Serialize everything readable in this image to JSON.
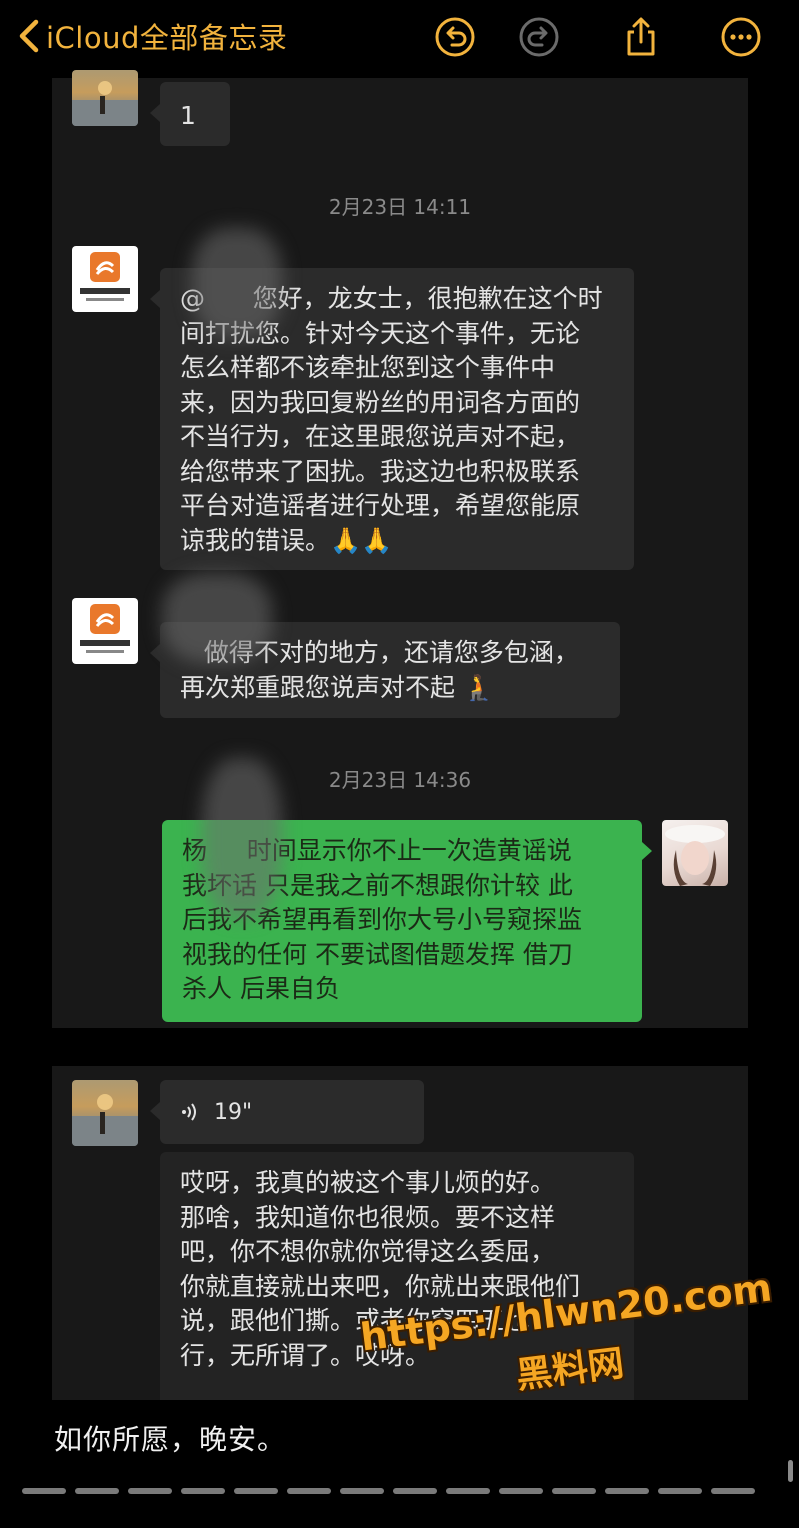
{
  "nav": {
    "back_label": "iCloud全部备忘录",
    "icons": [
      "chevron-left-icon",
      "undo-icon",
      "redo-icon",
      "share-icon",
      "more-icon"
    ]
  },
  "chat1": {
    "first_message": "1",
    "timestamp_1": "2月23日 14:11",
    "studio_message_1": "@      您好，龙女士，很抱歉在这个时\n间打扰您。针对今天这个事件，无论\n怎么样都不该牵扯您到这个事件中\n来，因为我回复粉丝的用词各方面的\n不当行为，在这里跟您说声对不起，\n给您带来了困扰。我这边也积极联系\n平台对造谣者进行处理，希望您能原\n谅我的错误。🙏🙏",
    "studio_message_2": "   做得不对的地方，还请您多包涵，\n再次郑重跟您说声对不起 🧎",
    "timestamp_2": "2月23日 14:36",
    "reply_message": "杨     时间显示你不止一次造黄谣说\n我坏话 只是我之前不想跟你计较 此\n后我不希望再看到你大号小号窥探监\n视我的任何 不要试图借题发挥 借刀\n杀人 后果自负"
  },
  "chat2": {
    "voice_duration": "19\"",
    "text_message": "哎呀，我真的被这个事儿烦的好。\n那啥，我知道你也很烦。要不这样\n吧，你不想你就你觉得这么委屈，\n你就直接就出来吧，你就出来跟他们\n说，跟他们撕。或者你穿四五也\n行，无所谓了。哎呀。"
  },
  "note": {
    "text": "如你所愿，晚安。"
  },
  "watermark": {
    "url": "https://hlwn20.com",
    "name": "黑料网"
  },
  "colors": {
    "accent": "#f2b33d",
    "green_bubble": "#3bb34f",
    "gray_bubble": "#2b2b2b",
    "background": "#000000"
  }
}
